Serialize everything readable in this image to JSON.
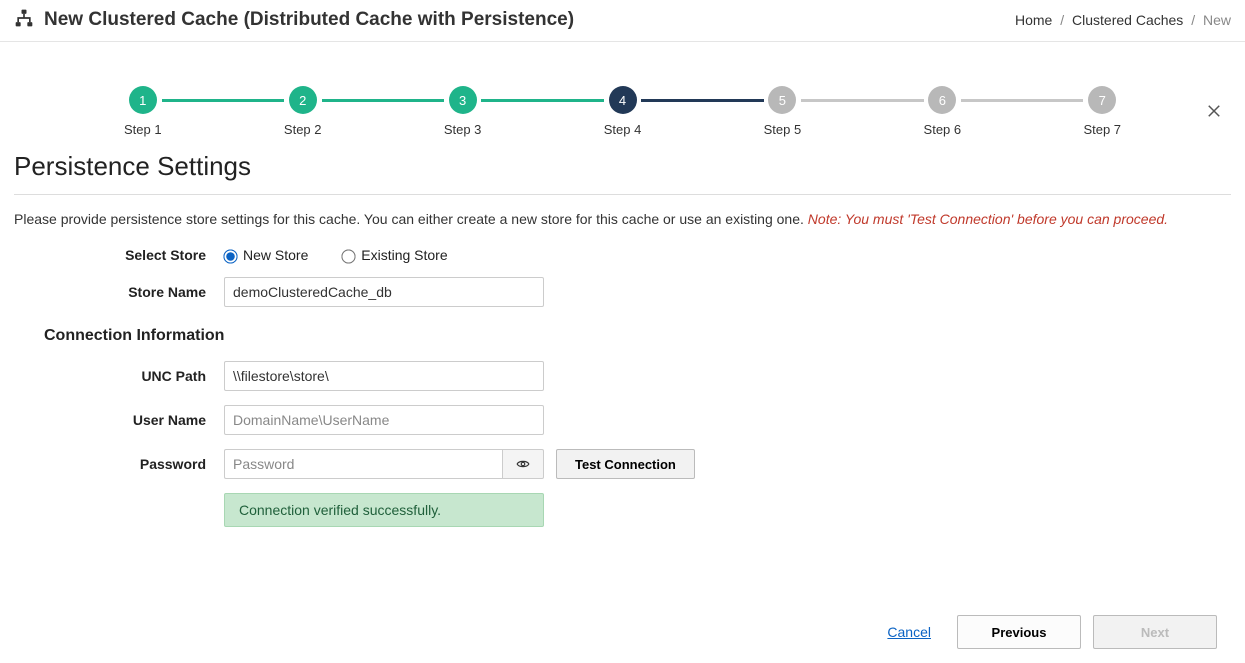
{
  "header": {
    "title": "New Clustered Cache (Distributed Cache with Persistence)"
  },
  "breadcrumb": {
    "home": "Home",
    "caches": "Clustered Caches",
    "current": "New"
  },
  "steps": {
    "s1": {
      "num": "1",
      "label": "Step 1"
    },
    "s2": {
      "num": "2",
      "label": "Step 2"
    },
    "s3": {
      "num": "3",
      "label": "Step 3"
    },
    "s4": {
      "num": "4",
      "label": "Step 4"
    },
    "s5": {
      "num": "5",
      "label": "Step 5"
    },
    "s6": {
      "num": "6",
      "label": "Step 6"
    },
    "s7": {
      "num": "7",
      "label": "Step 7"
    }
  },
  "section_title": "Persistence Settings",
  "intro": {
    "text": "Please provide persistence store settings for this cache. You can either create a new store for this cache or use an existing one. ",
    "note": "Note: You must 'Test Connection' before you can proceed."
  },
  "labels": {
    "select_store": "Select Store",
    "store_name": "Store Name",
    "connection_info": "Connection Information",
    "unc_path": "UNC Path",
    "user_name": "User Name",
    "password": "Password"
  },
  "options": {
    "new_store": "New Store",
    "existing_store": "Existing Store"
  },
  "values": {
    "store_name": "demoClusteredCache_db",
    "unc_path": "\\\\filestore\\store\\",
    "user_name_placeholder": "DomainName\\UserName",
    "password_placeholder": "Password"
  },
  "buttons": {
    "test_connection": "Test Connection",
    "cancel": "Cancel",
    "previous": "Previous",
    "next": "Next"
  },
  "messages": {
    "success": "Connection verified successfully."
  }
}
